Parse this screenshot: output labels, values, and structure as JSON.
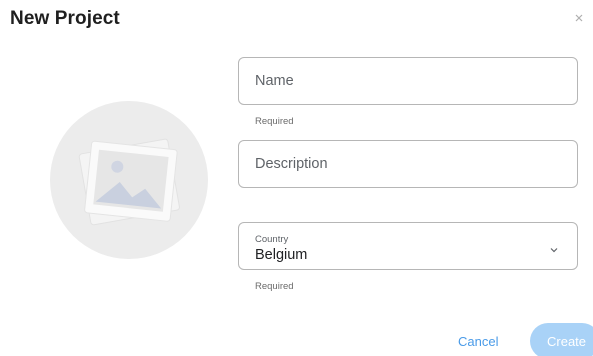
{
  "dialog": {
    "title": "New Project",
    "close_icon": "close-icon"
  },
  "image_placeholder": {
    "icon": "image-icon"
  },
  "form": {
    "name": {
      "placeholder": "Name",
      "value": "",
      "helper": "Required"
    },
    "description": {
      "placeholder": "Description",
      "value": ""
    },
    "country": {
      "label": "Country",
      "value": "Belgium",
      "helper": "Required",
      "icon": "chevron-down-icon"
    }
  },
  "actions": {
    "cancel_label": "Cancel",
    "create_label": "Create",
    "create_enabled": false
  },
  "colors": {
    "accent": "#4a9be8",
    "create_disabled_bg": "#a9d2f7",
    "border": "#b6b6b6",
    "placeholder_circle": "#ececec"
  }
}
